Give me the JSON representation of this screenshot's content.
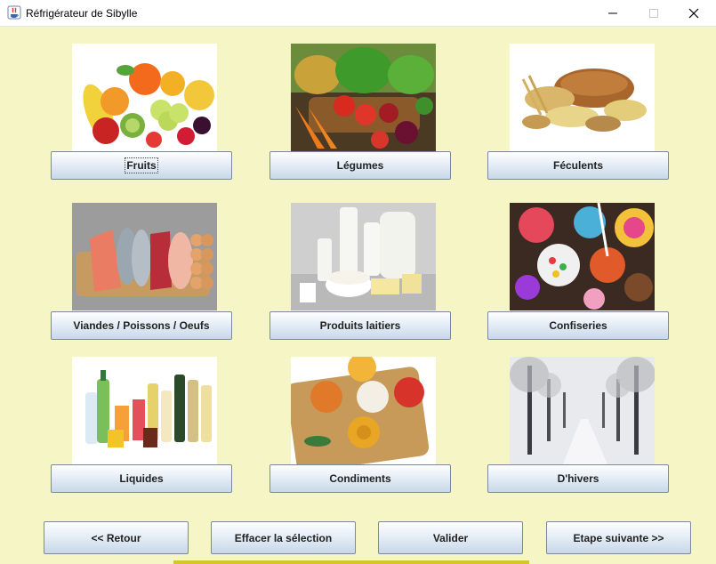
{
  "window": {
    "title": "Réfrigérateur de Sibylle",
    "controls": [
      "minimize-icon",
      "maximize-icon",
      "close-icon"
    ]
  },
  "categories": [
    {
      "label": "Fruits",
      "image": "fruits-photo"
    },
    {
      "label": "Légumes",
      "image": "vegetables-photo"
    },
    {
      "label": "Féculents",
      "image": "starches-photo"
    },
    {
      "label": "Viandes / Poissons / Oeufs",
      "image": "meat-fish-eggs-photo"
    },
    {
      "label": "Produits laitiers",
      "image": "dairy-photo"
    },
    {
      "label": "Confiseries",
      "image": "sweets-photo"
    },
    {
      "label": "Liquides",
      "image": "drinks-photo"
    },
    {
      "label": "Condiments",
      "image": "condiments-photo"
    },
    {
      "label": "D'hivers",
      "image": "winter-photo"
    }
  ],
  "nav": {
    "back": "<< Retour",
    "clear": "Effacer la sélection",
    "validate": "Valider",
    "next": "Etape suivante >>"
  },
  "colors": {
    "background": "#f6f5c6",
    "button_top": "#fdfeff",
    "button_bottom": "#c8d8e8",
    "button_border": "#7a8a9a"
  }
}
